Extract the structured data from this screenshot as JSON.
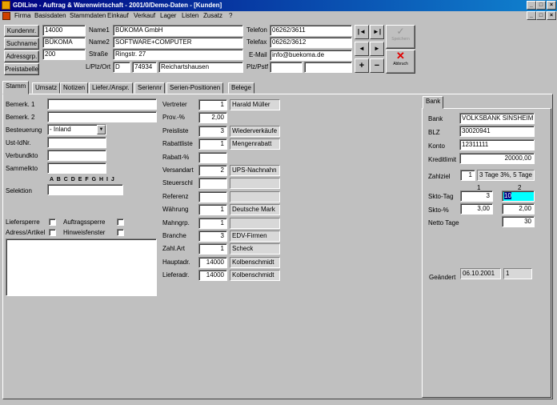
{
  "window": {
    "title": "GDILine - Auftrag & Warenwirtschaft - 2001/0/Demo-Daten - [Kunden]"
  },
  "menu": [
    "Firma",
    "Basisdaten",
    "Stammdaten",
    "Einkauf",
    "Verkauf",
    "Lager",
    "Listen",
    "Zusatz",
    "?"
  ],
  "header": {
    "buttons": {
      "kundennr": "Kundennr.",
      "suchname": "Suchname",
      "adressgrp": "Adressgrp.",
      "preistabelle": "Preistabelle"
    },
    "kundennr": "14000",
    "suchname": "BÜKOMA",
    "adressgrp": "200",
    "labels": {
      "name1": "Name1",
      "name2": "Name2",
      "strasse": "Straße",
      "lplzort": "L/Plz/Ort",
      "telefon": "Telefon",
      "telefax": "Telefax",
      "email": "E-Mail",
      "plzpstf": "Plz/Pstf"
    },
    "name1": "BÜKOMA GmbH",
    "name2": "SOFTWARE+COMPUTER",
    "strasse": "Ringstr. 27",
    "land": "D",
    "plz": "74934",
    "ort": "Reichartshausen",
    "telefon": "06262/3611",
    "telefax": "06262/3612",
    "email": "info@buekoma.de",
    "plz2": "",
    "pstf": "",
    "nav": {
      "first": "|◄",
      "last": "►|",
      "prev": "◄",
      "next": "►",
      "add": "+",
      "remove": "−"
    },
    "speichern": "Speichern",
    "abbruch": "Abbruch"
  },
  "tabs": [
    "Stamm",
    "Umsatz",
    "Notizen",
    "Liefer./Anspr.",
    "Seriennr",
    "Serien-Positionen",
    "Belege"
  ],
  "left": {
    "bemerk1_label": "Bemerk. 1",
    "bemerk2_label": "Bemerk. 2",
    "besteuerung_label": "Besteuerung",
    "besteuerung_value": "- Inland",
    "ustidnr_label": "Ust-IdNr.",
    "verbundkto_label": "Verbundkto",
    "sammelkto_label": "Sammelkto",
    "selektion_letters": "A B C D E F G H I J",
    "selektion_label": "Selektion",
    "liefersperre": "Liefersperre",
    "auftragssperre": "Auftragssperre",
    "adressartikel": "Adress/Artikel",
    "hinweisfenster": "Hinweisfenster"
  },
  "mid": {
    "rows": [
      {
        "label": "Vertreter",
        "value": "1",
        "desc": "Harald Müller"
      },
      {
        "label": "Prov.-%",
        "value": "2,00",
        "desc": null
      },
      {
        "label": "Preisliste",
        "value": "3",
        "desc": "Wiederverkäufe"
      },
      {
        "label": "Rabattliste",
        "value": "1",
        "desc": "Mengenrabatt"
      },
      {
        "label": "Rabatt-%",
        "value": "",
        "desc": null
      },
      {
        "label": "Versandart",
        "value": "2",
        "desc": "UPS-Nachnahn"
      },
      {
        "label": "Steuerschl",
        "value": "",
        "desc": ""
      },
      {
        "label": "Referenz",
        "value": "",
        "desc": ""
      },
      {
        "label": "Währung",
        "value": "1",
        "desc": "Deutsche Mark"
      },
      {
        "label": "Mahngrp.",
        "value": "1",
        "desc": ""
      },
      {
        "label": "Branche",
        "value": "3",
        "desc": "EDV-Firmen"
      },
      {
        "label": "Zahl.Art",
        "value": "1",
        "desc": "Scheck"
      },
      {
        "label": "Hauptadr.",
        "value": "14000",
        "desc": "Kolbenschmidt"
      },
      {
        "label": "Lieferadr.",
        "value": "14000",
        "desc": "Kolbenschmidt"
      }
    ]
  },
  "bank": {
    "tab": "Bank",
    "bank_label": "Bank",
    "bank": "VOLKSBANK SINSHEIM",
    "blz_label": "BLZ",
    "blz": "30020941",
    "konto_label": "Konto",
    "konto": "12311111",
    "kreditlimit_label": "Kreditlimit",
    "kreditlimit": "20000,00",
    "zahlziel_label": "Zahlziel",
    "zahlziel": "1",
    "zahlziel_desc": "3 Tage 3%, 5 Tage",
    "col1": "1",
    "col2": "2",
    "skto_tag_label": "Skto-Tag",
    "skto_tag1": "3",
    "skto_tag2": "10",
    "skto_pct_label": "Skto-%",
    "skto_pct1": "3,00",
    "skto_pct2": "2,00",
    "netto_label": "Netto Tage",
    "netto": "30",
    "geaendert_label": "Geändert",
    "geaendert": "06.10.2001",
    "geaendert_user": "1"
  }
}
